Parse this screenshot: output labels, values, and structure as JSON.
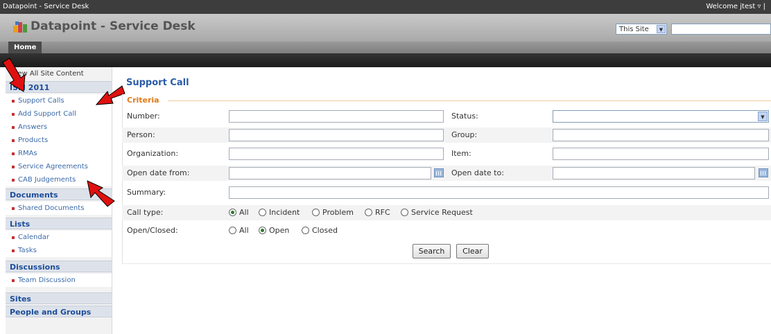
{
  "topbar": {
    "site_name": "Datapoint - Service Desk",
    "welcome": "Welcome jtest ▿ |"
  },
  "header": {
    "title": "Datapoint - Service Desk",
    "scope": "This Site",
    "scope_arrow": "▼"
  },
  "nav": {
    "home": "Home"
  },
  "leftnav": {
    "view_all": "View All Site Content",
    "sections": [
      {
        "heading": "ISM 2011",
        "items": [
          "Support Calls",
          "Add Support Call",
          "Answers",
          "Products",
          "RMAs",
          "Service Agreements",
          "CAB Judgements"
        ]
      },
      {
        "heading": "Documents",
        "items": [
          "Shared Documents"
        ]
      },
      {
        "heading": "Lists",
        "items": [
          "Calendar",
          "Tasks"
        ]
      },
      {
        "heading": "Discussions",
        "items": [
          "Team Discussion"
        ]
      },
      {
        "heading": "Sites",
        "items": []
      },
      {
        "heading": "People and Groups",
        "items": []
      }
    ]
  },
  "main": {
    "title": "Support Call",
    "criteria": "Criteria",
    "labels": {
      "number": "Number:",
      "status": "Status:",
      "person": "Person:",
      "group": "Group:",
      "organization": "Organization:",
      "item": "Item:",
      "open_from": "Open date from:",
      "open_to": "Open date to:",
      "summary": "Summary:",
      "call_type": "Call type:",
      "open_closed": "Open/Closed:"
    },
    "fields": {
      "number": "",
      "status": "",
      "person": "",
      "group": "",
      "organization": "",
      "item": "",
      "open_from": "",
      "open_to": "",
      "summary": ""
    },
    "call_types": [
      "All",
      "Incident",
      "Problem",
      "RFC",
      "Service Request"
    ],
    "call_type_selected": "All",
    "open_closed_options": [
      "All",
      "Open",
      "Closed"
    ],
    "open_closed_selected": "Open",
    "search_button": "Search",
    "clear_button": "Clear"
  },
  "colors": {
    "accent": "#2b5ca8",
    "criteria": "#e07b1c",
    "arrow": "#e01010"
  }
}
